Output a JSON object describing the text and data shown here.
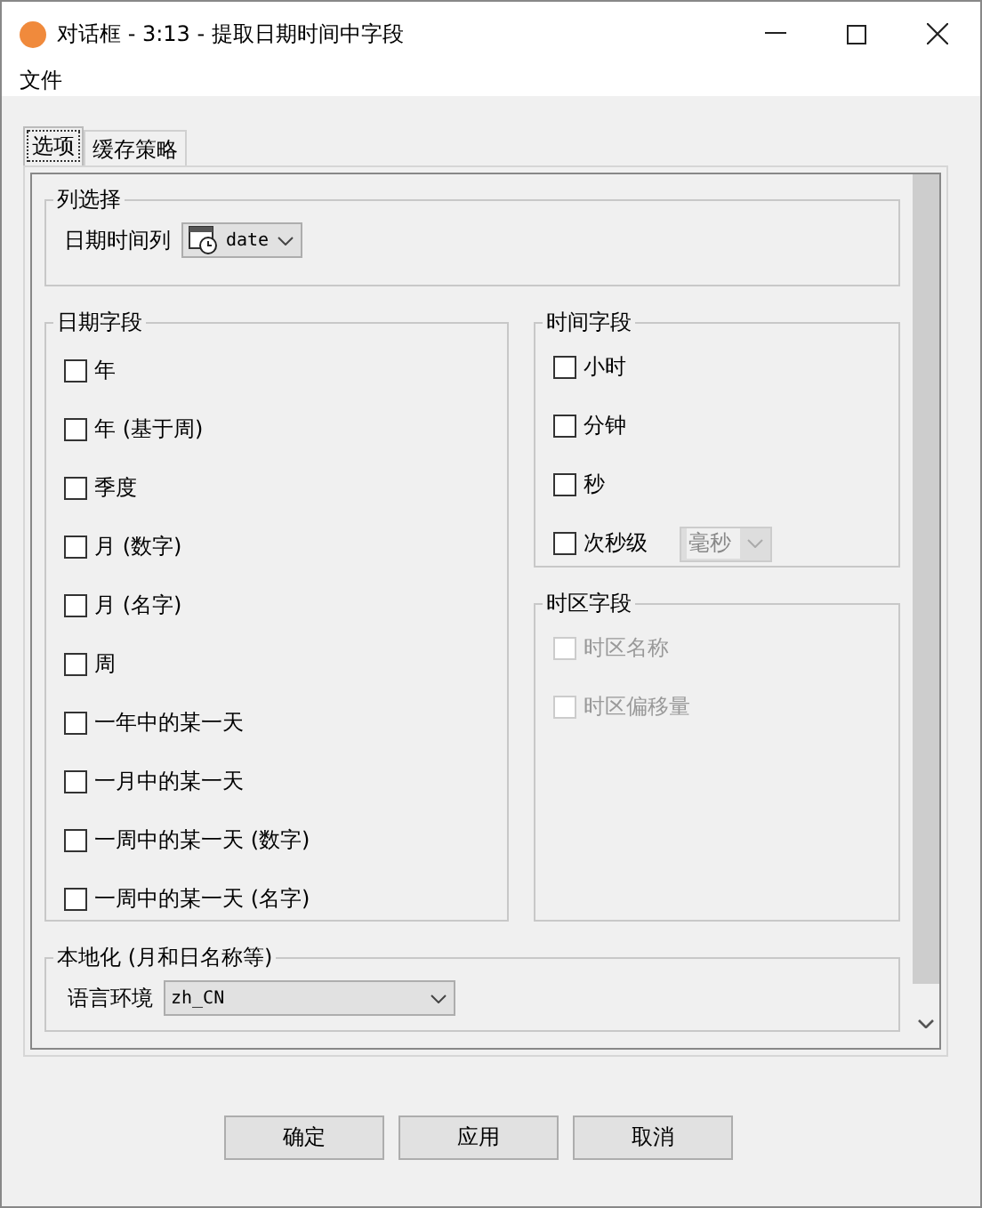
{
  "window": {
    "title": "对话框 - 3:13 - 提取日期时间中字段"
  },
  "menu": [
    "文件"
  ],
  "tabs": [
    {
      "label": "选项",
      "selected": true
    },
    {
      "label": "缓存策略",
      "selected": false
    }
  ],
  "column_selection": {
    "title": "列选择",
    "label": "日期时间列",
    "value": "date"
  },
  "date_fields": {
    "title": "日期字段",
    "items": [
      {
        "label": "年",
        "checked": false
      },
      {
        "label": "年 (基于周)",
        "checked": false
      },
      {
        "label": "季度",
        "checked": false
      },
      {
        "label": "月 (数字)",
        "checked": false
      },
      {
        "label": "月 (名字)",
        "checked": false
      },
      {
        "label": "周",
        "checked": false
      },
      {
        "label": "一年中的某一天",
        "checked": false
      },
      {
        "label": "一月中的某一天",
        "checked": false
      },
      {
        "label": "一周中的某一天 (数字)",
        "checked": false
      },
      {
        "label": "一周中的某一天 (名字)",
        "checked": false
      }
    ]
  },
  "time_fields": {
    "title": "时间字段",
    "items": [
      {
        "label": "小时",
        "checked": false
      },
      {
        "label": "分钟",
        "checked": false
      },
      {
        "label": "秒",
        "checked": false
      },
      {
        "label": "次秒级",
        "checked": false,
        "unit": {
          "value": "毫秒",
          "disabled": true
        }
      }
    ]
  },
  "timezone_fields": {
    "title": "时区字段",
    "items": [
      {
        "label": "时区名称",
        "checked": false,
        "disabled": true
      },
      {
        "label": "时区偏移量",
        "checked": false,
        "disabled": true
      }
    ]
  },
  "localization": {
    "title": "本地化 (月和日名称等)",
    "label": "语言环境",
    "value": "zh_CN"
  },
  "buttons": [
    "确定",
    "应用",
    "取消"
  ]
}
